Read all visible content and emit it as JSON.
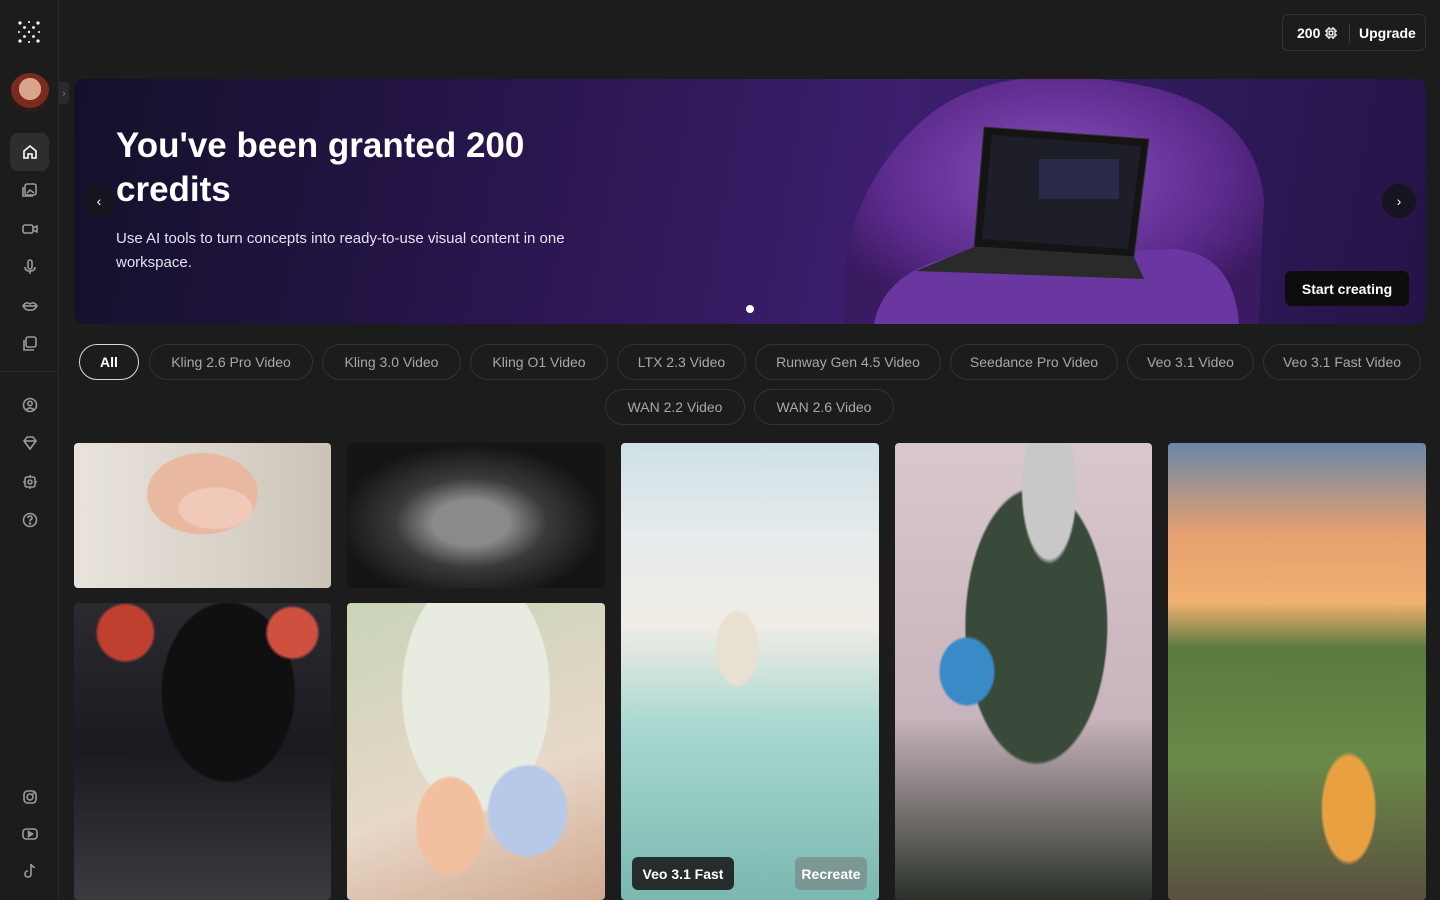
{
  "credits": {
    "amount": "200",
    "upgrade_label": "Upgrade"
  },
  "sidebar": {
    "items": [
      {
        "name": "home"
      },
      {
        "name": "image"
      },
      {
        "name": "video"
      },
      {
        "name": "audio"
      },
      {
        "name": "lipsync"
      },
      {
        "name": "library"
      },
      {
        "name": "account"
      },
      {
        "name": "pricing"
      },
      {
        "name": "settings"
      },
      {
        "name": "help"
      },
      {
        "name": "instagram"
      },
      {
        "name": "youtube"
      },
      {
        "name": "tiktok"
      }
    ]
  },
  "banner": {
    "title": "You've been granted 200 credits",
    "subtitle": "Use AI tools to turn concepts into ready-to-use visual content in one workspace.",
    "cta": "Start creating",
    "prev": "‹",
    "next": "›"
  },
  "filters": [
    "All",
    "Kling 2.6 Pro Video",
    "Kling 3.0 Video",
    "Kling O1 Video",
    "LTX 2.3 Video",
    "Runway Gen 4.5 Video",
    "Seedance Pro Video",
    "Veo 3.1 Video",
    "Veo 3.1 Fast Video",
    "WAN 2.2 Video",
    "WAN 2.6 Video"
  ],
  "gallery": {
    "hover_model": "Veo 3.1 Fast",
    "hover_action": "Recreate"
  }
}
